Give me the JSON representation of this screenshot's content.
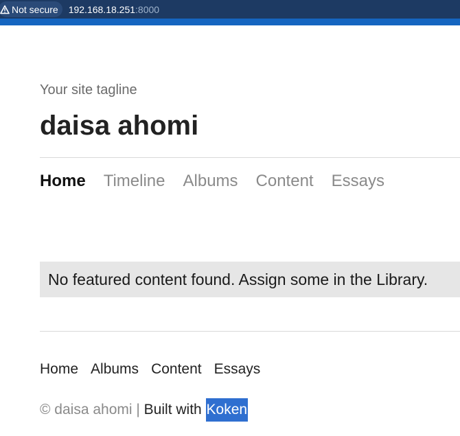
{
  "browser": {
    "security_label": "Not secure",
    "url_host": "192.168.18.251",
    "url_port": ":8000"
  },
  "site": {
    "tagline": "Your site tagline",
    "title": "daisa ahomi"
  },
  "nav": {
    "items": [
      {
        "label": "Home",
        "active": true
      },
      {
        "label": "Timeline"
      },
      {
        "label": "Albums"
      },
      {
        "label": "Content"
      },
      {
        "label": "Essays"
      }
    ]
  },
  "main": {
    "notice": "No featured content found. Assign some in the Library."
  },
  "footer": {
    "nav": [
      "Home",
      "Albums",
      "Content",
      "Essays"
    ],
    "copyright": "© daisa ahomi | ",
    "built_with": "Built with ",
    "koken_link": "Koken"
  },
  "colors": {
    "urlbar_bg": "#1d3a63",
    "accent_strip": "#1565c0",
    "link_highlight": "#2f6fd0"
  }
}
